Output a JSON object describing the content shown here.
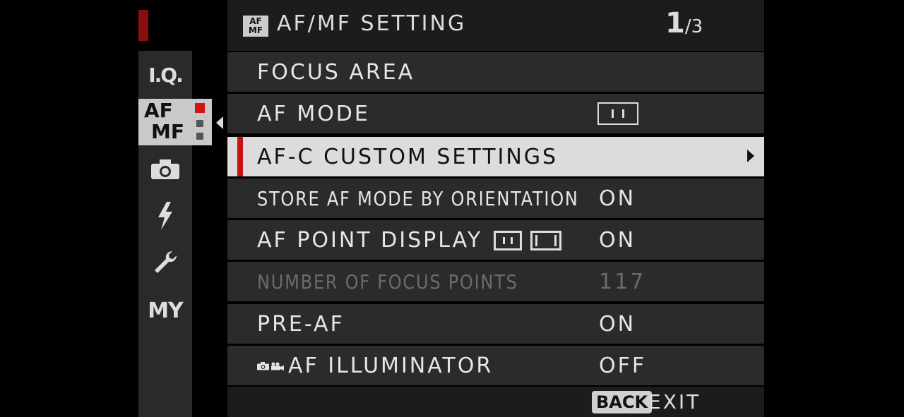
{
  "header": {
    "icon_top": "AF",
    "icon_bottom": "MF",
    "title": "AF/MF SETTING",
    "page_current": "1",
    "page_total": "/3"
  },
  "sidebar": {
    "iq": "I.Q.",
    "af_line1": "AF",
    "af_line2": "MF",
    "my": "MY"
  },
  "menu": {
    "focus_area": {
      "label": "FOCUS AREA"
    },
    "af_mode": {
      "label": "AF MODE"
    },
    "afc_custom": {
      "label": "AF-C CUSTOM SETTINGS"
    },
    "store_af": {
      "label": "STORE AF MODE BY ORIENTATION",
      "value": "ON"
    },
    "af_point_display": {
      "label": "AF POINT DISPLAY",
      "value": "ON"
    },
    "num_points": {
      "label": "NUMBER OF FOCUS POINTS",
      "value": "117"
    },
    "pre_af": {
      "label": "PRE-AF",
      "value": "ON"
    },
    "af_illuminator": {
      "label": "AF ILLUMINATOR",
      "value": "OFF"
    }
  },
  "footer": {
    "back": "BACK",
    "exit": "EXIT"
  },
  "colors": {
    "accent_red": "#c81212",
    "selected_row": "#dcdcdc",
    "row_bg": "#2b2b2b",
    "sidebar_bg": "#2a2a2a"
  }
}
